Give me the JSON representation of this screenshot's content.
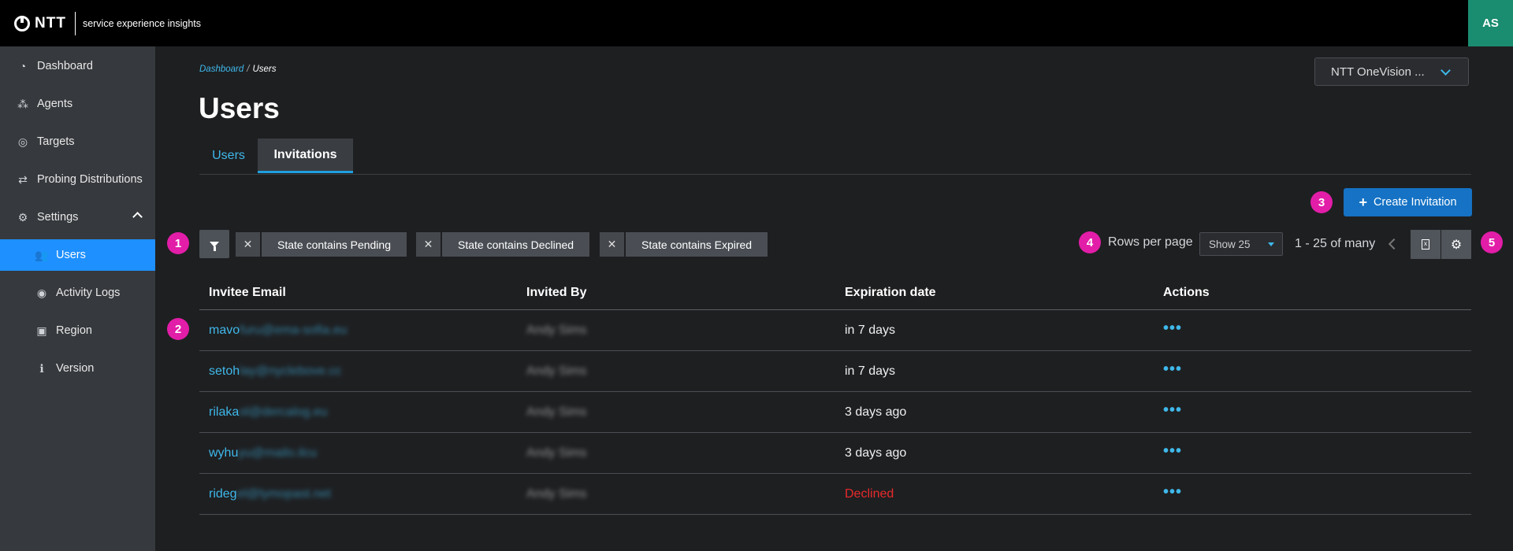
{
  "header": {
    "brand": "NTT",
    "tagline": "service experience insights",
    "avatar_initials": "AS",
    "colors": {
      "topbar": "#000000",
      "avatar": "#1a8c6f"
    }
  },
  "sidebar": {
    "items": [
      {
        "label": "Dashboard",
        "icon": "speedometer-icon"
      },
      {
        "label": "Agents",
        "icon": "network-nodes-icon"
      },
      {
        "label": "Targets",
        "icon": "target-icon"
      },
      {
        "label": "Probing Distributions",
        "icon": "arrows-exchange-icon"
      },
      {
        "label": "Settings",
        "icon": "gear-icon",
        "expanded": true
      },
      {
        "label": "Users",
        "icon": "users-icon",
        "active": true
      },
      {
        "label": "Activity Logs",
        "icon": "eye-icon"
      },
      {
        "label": "Region",
        "icon": "id-card-icon"
      },
      {
        "label": "Version",
        "icon": "info-icon"
      }
    ],
    "active_color": "#1e90ff"
  },
  "breadcrumb": {
    "parent": "Dashboard",
    "separator": "/",
    "current": "Users"
  },
  "page": {
    "title": "Users"
  },
  "org_select": {
    "value": "NTT OneVision ..."
  },
  "tabs": [
    {
      "label": "Users",
      "active": false
    },
    {
      "label": "Invitations",
      "active": true
    }
  ],
  "toolbar": {
    "create_label": "Create Invitation",
    "filters": [
      {
        "label": "State contains Pending"
      },
      {
        "label": "State contains Declined"
      },
      {
        "label": "State contains Expired"
      }
    ],
    "rows_per_page_label": "Rows per page",
    "rows_per_page_value": "Show 25",
    "page_range": "1 - 25 of many"
  },
  "markers": [
    "1",
    "2",
    "3",
    "4",
    "5"
  ],
  "table": {
    "columns": [
      "Invitee Email",
      "Invited By",
      "Expiration date",
      "Actions"
    ],
    "rows": [
      {
        "email_visible": "mavo",
        "email_blurred": "furu@ema-sofia.eu",
        "invited_by": "Andy Sims",
        "expiration": "in 7 days",
        "status": "normal",
        "actions": "•••"
      },
      {
        "email_visible": "setoh",
        "email_blurred": "lay@nyclebove.cc",
        "invited_by": "Andy Sims",
        "expiration": "in 7 days",
        "status": "normal",
        "actions": "•••"
      },
      {
        "email_visible": "rilaka",
        "email_blurred": "ol@dercalog.eu",
        "invited_by": "Andy Sims",
        "expiration": "3 days ago",
        "status": "normal",
        "actions": "•••"
      },
      {
        "email_visible": "wyhu",
        "email_blurred": "yu@mailo.ilcu",
        "invited_by": "Andy Sims",
        "expiration": "3 days ago",
        "status": "normal",
        "actions": "•••"
      },
      {
        "email_visible": "rideg",
        "email_blurred": "el@lymopast.net",
        "invited_by": "Andy Sims",
        "expiration": "Declined",
        "status": "declined",
        "actions": "•••"
      }
    ]
  }
}
